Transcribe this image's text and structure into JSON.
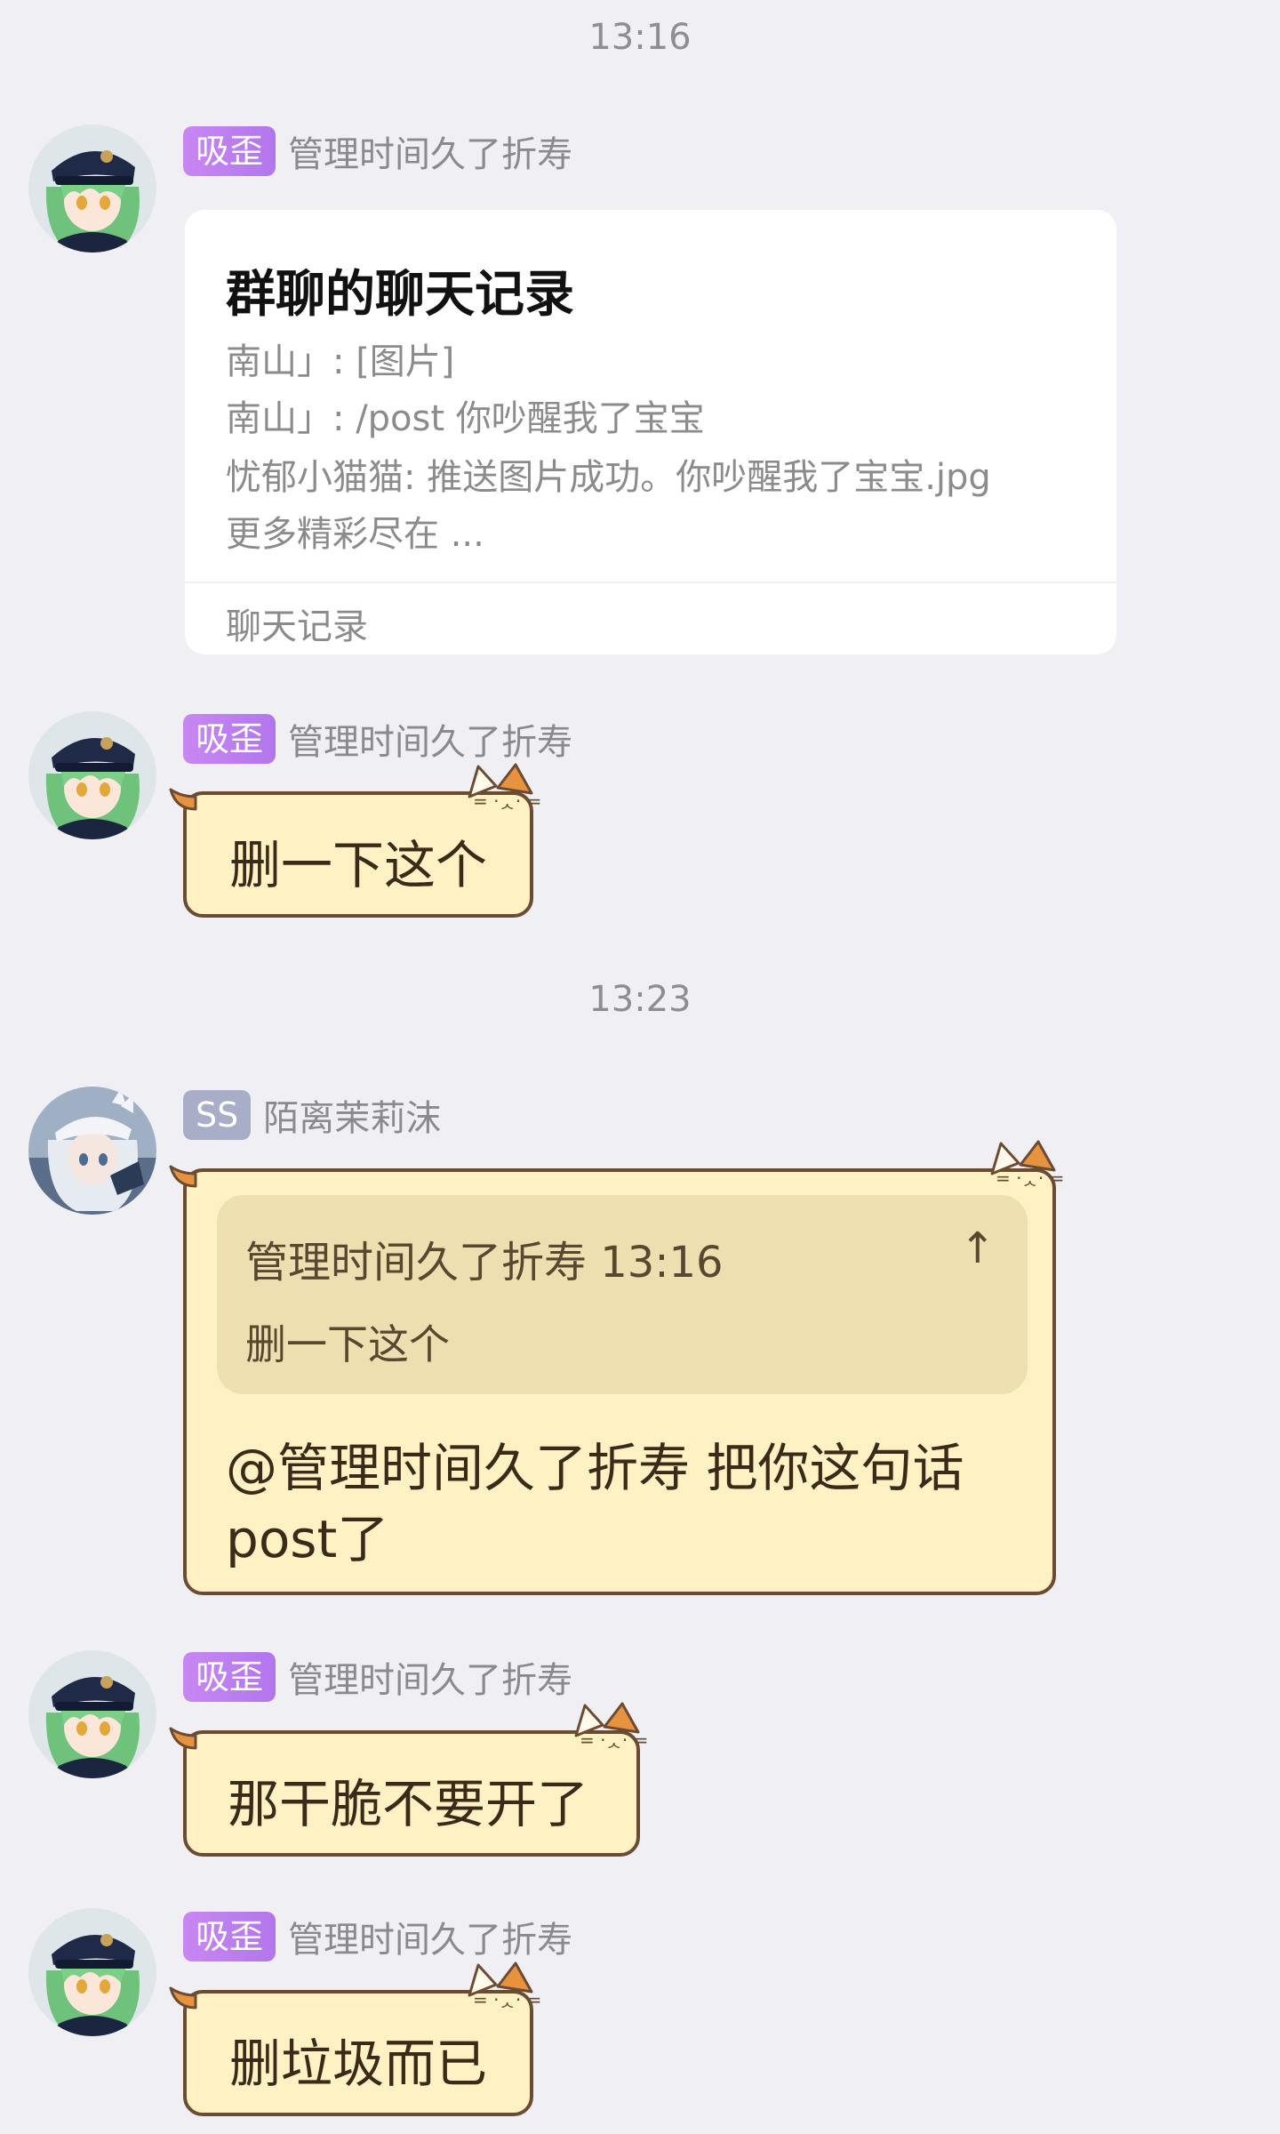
{
  "timestamps": [
    "13:16",
    "13:23"
  ],
  "messages": [
    {
      "badge": "吸歪",
      "sender": "管理时间久了折寿",
      "card": {
        "title": "群聊的聊天记录",
        "lines": [
          "南山」: [图片]",
          "南山」: /post 你吵醒我了宝宝",
          "忧郁小猫猫: 推送图片成功。你吵醒我了宝宝.jpg",
          "更多精彩尽在 ..."
        ],
        "footer": "聊天记录"
      }
    },
    {
      "badge": "吸歪",
      "sender": "管理时间久了折寿",
      "text": "删一下这个"
    },
    {
      "badge": "SS",
      "sender": "陌离茉莉沫",
      "quote": {
        "header": "管理时间久了折寿 13:16",
        "arrow": "↑",
        "body": "删一下这个"
      },
      "text_lines": [
        "@管理时间久了折寿 把你这句话",
        "post了"
      ]
    },
    {
      "badge": "吸歪",
      "sender": "管理时间久了折寿",
      "text": "那干脆不要开了"
    },
    {
      "badge": "吸歪",
      "sender": "管理时间久了折寿",
      "text": "删垃圾而已"
    }
  ],
  "colors": {
    "background": "#efeff4",
    "badge_purple": "#b276ec",
    "badge_gray": "#a8aec8",
    "bubble_fill": "#fef2c5",
    "bubble_border": "#6b4c32",
    "quote_fill": "#eedfb1"
  }
}
